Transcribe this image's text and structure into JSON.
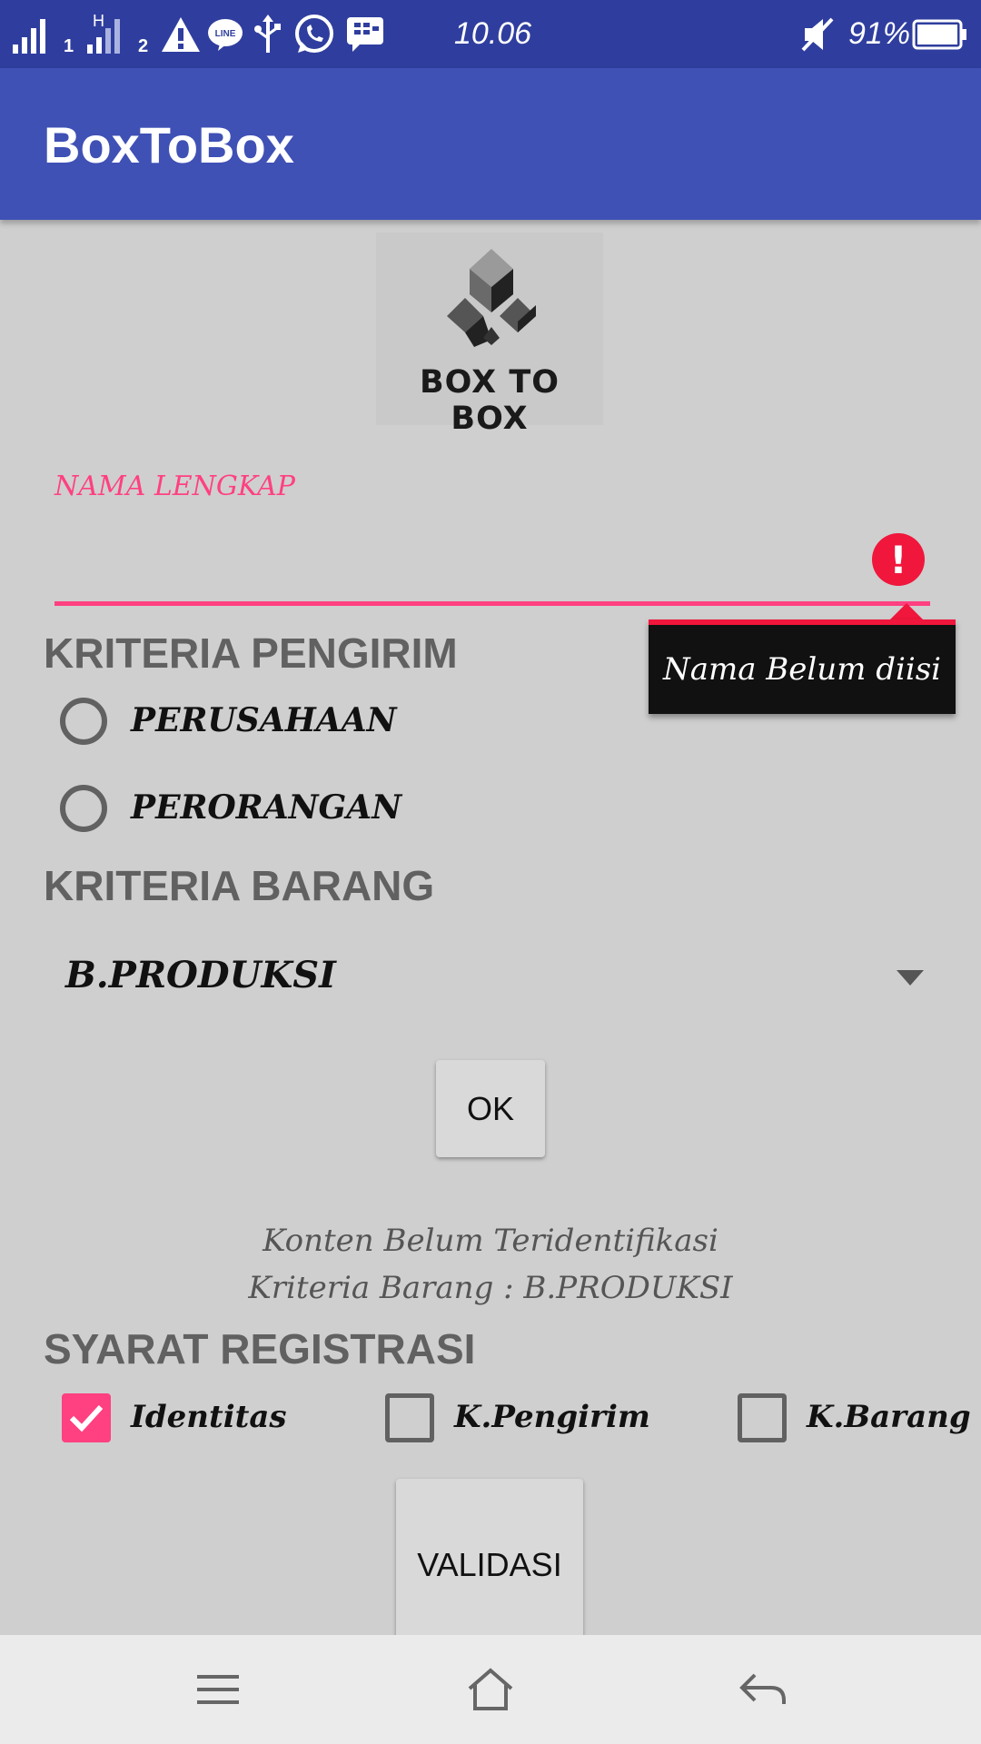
{
  "status_bar": {
    "time": "10.06",
    "battery_percent": "91%",
    "sim1_label": "1",
    "sim2_label": "2",
    "network_type": "H",
    "line_label": "LINE",
    "icons": [
      "signal-icon",
      "signal-icon",
      "warning-icon",
      "line-icon",
      "usb-icon",
      "whatsapp-icon",
      "bbm-icon",
      "mute-icon",
      "battery-icon"
    ]
  },
  "app_bar": {
    "title": "BoxToBox"
  },
  "logo": {
    "text": "BOX TO BOX"
  },
  "form": {
    "name_field": {
      "label": "NAMA LENGKAP",
      "value": "",
      "error_icon": "!",
      "error_text": "Nama Belum diisi"
    },
    "sender_section": {
      "title": "KRITERIA PENGIRIM",
      "options": [
        "PERUSAHAAN",
        "PERORANGAN"
      ]
    },
    "goods_section": {
      "title": "KRITERIA BARANG",
      "selected": "B.PRODUKSI"
    },
    "ok_button": "OK",
    "info_line1": "Konten Belum Teridentifikasi",
    "info_line2": "Kriteria Barang : B.PRODUKSI",
    "requirements": {
      "title": "SYARAT REGISTRASI",
      "items": [
        {
          "label": "Identitas",
          "checked": true
        },
        {
          "label": "K.Pengirim",
          "checked": false
        },
        {
          "label": "K.Barang",
          "checked": false
        }
      ]
    },
    "validate_button": "VALIDASI"
  },
  "nav_bar": {
    "icons": [
      "menu-icon",
      "home-icon",
      "back-icon"
    ]
  },
  "colors": {
    "status_bar": "#2f3e9e",
    "app_bar": "#3f51b5",
    "accent": "#ff4081",
    "error": "#f0163c"
  }
}
